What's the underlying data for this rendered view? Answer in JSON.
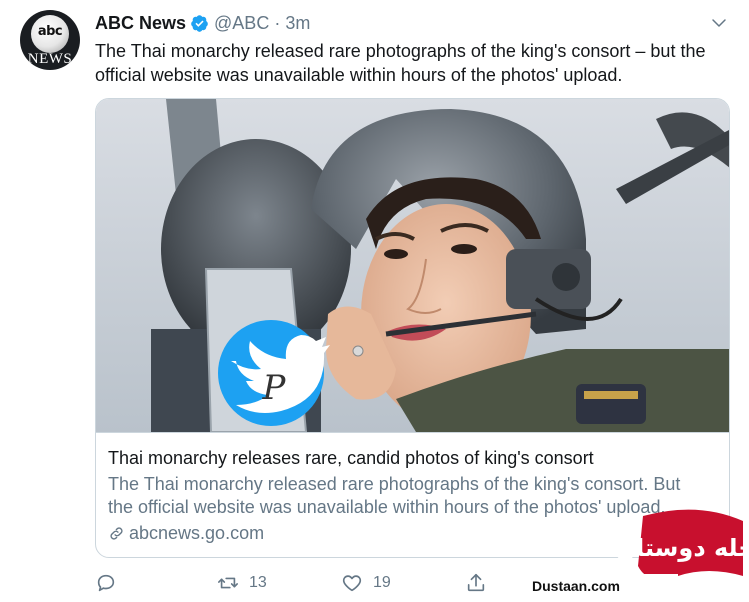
{
  "author": {
    "display_name": "ABC News",
    "handle": "@ABC",
    "separator": "·",
    "time": "3m",
    "avatar": {
      "top_text": "abc",
      "bottom_text": "NEWS"
    }
  },
  "tweet": {
    "text": "The Thai monarchy released rare photographs of the king's consort – but the official website was unavailable within hours of the photos' upload."
  },
  "card": {
    "title": "Thai monarchy releases rare, candid photos of king's consort",
    "description": "The Thai monarchy released rare photographs of the king's consort. But the official website was unavailable within hours of the photos' upload.",
    "domain": "abcnews.go.com",
    "overlay_letter": "P"
  },
  "actions": {
    "reply_count": "",
    "retweet_count": "13",
    "like_count": "19"
  },
  "watermark": {
    "site": "Dustaan.com",
    "script_text": "مجله دوستان"
  },
  "colors": {
    "brand_blue": "#1da1f2",
    "secondary_text": "#657786",
    "primary_text": "#14171a",
    "border": "#ccd6dd",
    "watermark_red": "#c8102e"
  },
  "icons": [
    "verified-badge-icon",
    "chevron-down-icon",
    "link-icon",
    "reply-icon",
    "retweet-icon",
    "like-icon",
    "share-icon",
    "twitter-bird-icon"
  ]
}
